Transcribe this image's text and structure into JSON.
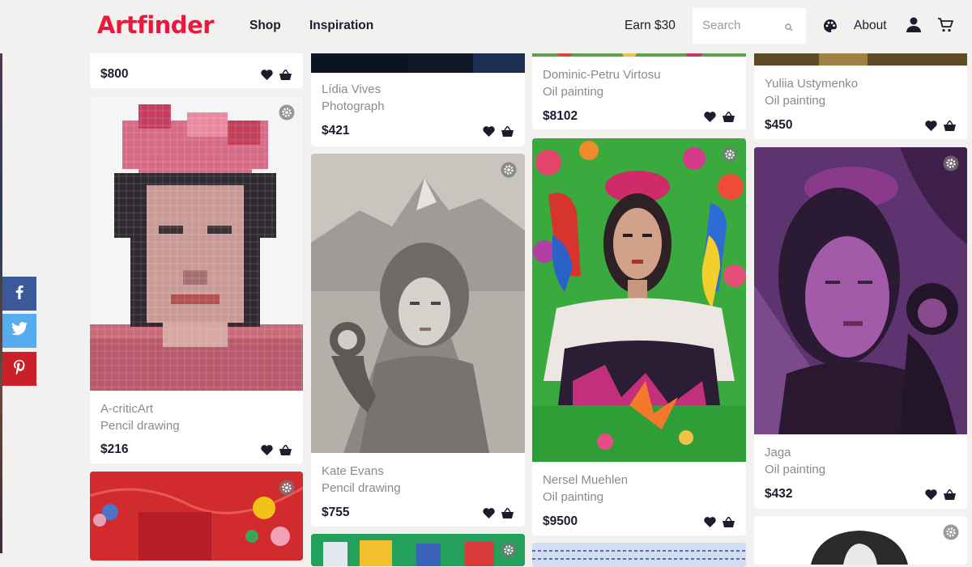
{
  "header": {
    "logo": "Artfinder",
    "nav": {
      "shop": "Shop",
      "inspiration": "Inspiration"
    },
    "earn": "Earn $30",
    "search_placeholder": "Search",
    "about": "About"
  },
  "social": {
    "facebook": "f",
    "twitter": "t",
    "pinterest": "p"
  },
  "cards": [
    {
      "price": "$800"
    },
    {
      "artist": "A-criticArt",
      "medium": "Pencil drawing",
      "price": "$216"
    },
    {
      "artist": "Lídia Vives",
      "medium": "Photograph",
      "price": "$421"
    },
    {
      "artist": "Kate Evans",
      "medium": "Pencil drawing",
      "price": "$755"
    },
    {
      "artist": "Dominic-Petru Virtosu",
      "medium": "Oil painting",
      "price": "$8102"
    },
    {
      "artist": "Nersel Muehlen",
      "medium": "Oil painting",
      "price": "$9500"
    },
    {
      "artist": "Yuliia Ustymenko",
      "medium": "Oil painting",
      "price": "$450"
    },
    {
      "artist": "Jaga",
      "medium": "Oil painting",
      "price": "$432"
    }
  ],
  "colors": {
    "brand": "#e8193c",
    "text": "#1c1c2e",
    "muted": "#8a8a8a",
    "background": "#f3f1ef"
  },
  "icons": [
    "search-icon",
    "palette-icon",
    "user-icon",
    "cart-icon",
    "heart-icon",
    "basket-icon",
    "gear-icon",
    "facebook-icon",
    "twitter-icon",
    "pinterest-icon"
  ]
}
